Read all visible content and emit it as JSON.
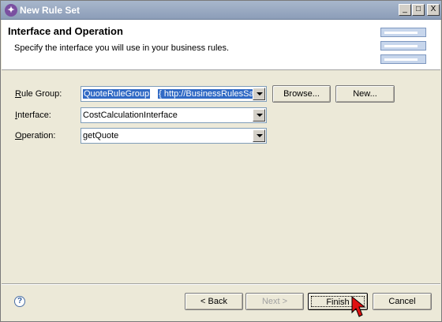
{
  "window": {
    "title": "New Rule Set",
    "icon": "wizard-icon",
    "controls": {
      "minimize": "_",
      "maximize": "□",
      "close": "X"
    }
  },
  "header": {
    "title": "Interface and Operation",
    "description": "Specify the interface you will use in your business rules."
  },
  "form": {
    "rule_group": {
      "label_underlined": "R",
      "label_rest": "ule Group:",
      "value": "QuoteRuleGroup",
      "value_suffix": "{ http://BusinessRulesSar"
    },
    "interface": {
      "label_underlined": "I",
      "label_rest": "nterface:",
      "value": "CostCalculationInterface"
    },
    "operation": {
      "label_underlined": "O",
      "label_rest": "peration:",
      "value": "getQuote"
    },
    "browse_label": "Browse...",
    "new_label": "New..."
  },
  "footer": {
    "help_glyph": "?",
    "back_label": "< Back",
    "next_label": "Next >",
    "finish_label": "Finish",
    "cancel_label": "Cancel"
  },
  "colors": {
    "accent": "#316ac5",
    "cursor": "#e01010"
  }
}
